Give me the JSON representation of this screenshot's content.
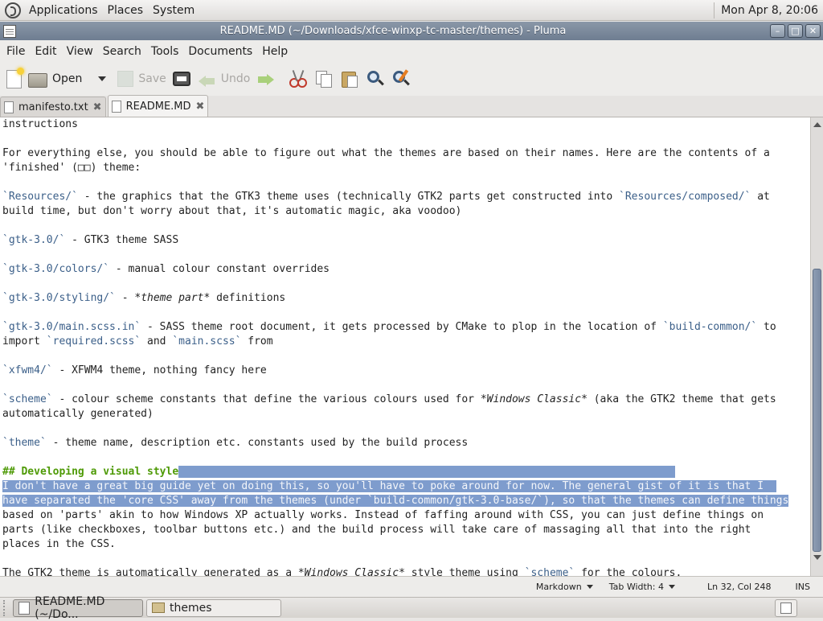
{
  "top_panel": {
    "menus": [
      "Applications",
      "Places",
      "System"
    ],
    "clock": "Mon Apr  8, 20:06"
  },
  "window": {
    "title": "README.MD (~/Downloads/xfce-winxp-tc-master/themes) - Pluma"
  },
  "menubar": {
    "items": [
      "File",
      "Edit",
      "View",
      "Search",
      "Tools",
      "Documents",
      "Help"
    ]
  },
  "toolbar": {
    "open_label": "Open",
    "save_label": "Save",
    "undo_label": "Undo"
  },
  "tabs": [
    {
      "label": "manifesto.txt",
      "active": false
    },
    {
      "label": "README.MD",
      "active": true
    }
  ],
  "editor": {
    "lines": [
      [
        {
          "t": "instructions"
        }
      ],
      [
        {
          "t": ""
        }
      ],
      [
        {
          "t": "For everything else, you should be able to figure out what the themes are based on their names. Here are the contents of a"
        }
      ],
      [
        {
          "t": "'finished' (□□) theme:"
        }
      ],
      [
        {
          "t": ""
        }
      ],
      [
        {
          "t": "`Resources/`",
          "c": "code"
        },
        {
          "t": " - the graphics that the GTK3 theme uses (technically GTK2 parts get constructed into "
        },
        {
          "t": "`Resources/composed/`",
          "c": "code"
        },
        {
          "t": " at"
        }
      ],
      [
        {
          "t": "build time, but don't worry about that, it's automatic magic, aka voodoo)"
        }
      ],
      [
        {
          "t": ""
        }
      ],
      [
        {
          "t": "`gtk-3.0/`",
          "c": "code"
        },
        {
          "t": " - GTK3 theme SASS"
        }
      ],
      [
        {
          "t": ""
        }
      ],
      [
        {
          "t": "`gtk-3.0/colors/`",
          "c": "code"
        },
        {
          "t": " - manual colour constant overrides"
        }
      ],
      [
        {
          "t": ""
        }
      ],
      [
        {
          "t": "`gtk-3.0/styling/`",
          "c": "code"
        },
        {
          "t": " - "
        },
        {
          "t": "*theme part*",
          "c": "emph"
        },
        {
          "t": " definitions"
        }
      ],
      [
        {
          "t": ""
        }
      ],
      [
        {
          "t": "`gtk-3.0/main.scss.in`",
          "c": "code"
        },
        {
          "t": " - SASS theme root document, it gets processed by CMake to plop in the location of "
        },
        {
          "t": "`build-common/`",
          "c": "code"
        },
        {
          "t": " to"
        }
      ],
      [
        {
          "t": "import "
        },
        {
          "t": "`required.scss`",
          "c": "code"
        },
        {
          "t": " and "
        },
        {
          "t": "`main.scss`",
          "c": "code"
        },
        {
          "t": " from"
        }
      ],
      [
        {
          "t": ""
        }
      ],
      [
        {
          "t": "`xfwm4/`",
          "c": "code"
        },
        {
          "t": " - XFWM4 theme, nothing fancy here"
        }
      ],
      [
        {
          "t": ""
        }
      ],
      [
        {
          "t": "`scheme`",
          "c": "code"
        },
        {
          "t": " - colour scheme constants that define the various colours used for "
        },
        {
          "t": "*Windows Classic*",
          "c": "emph"
        },
        {
          "t": " (aka the GTK2 theme that gets"
        }
      ],
      [
        {
          "t": "automatically generated)"
        }
      ],
      [
        {
          "t": ""
        }
      ],
      [
        {
          "t": "`theme`",
          "c": "code"
        },
        {
          "t": " - theme name, description etc. constants used by the build process"
        }
      ],
      [
        {
          "t": ""
        }
      ],
      [
        {
          "t": "## Developing a visual style",
          "c": "heading"
        },
        {
          "t": "                                                                               ",
          "c": "sel"
        }
      ],
      [
        {
          "t": "I don't have a great big guide yet on doing this, so you'll have to poke around for now. The general gist of it is that I  ",
          "c": "sel"
        }
      ],
      [
        {
          "t": "have separated the 'core CSS' away from the themes (under `build-common/gtk-3.0-base/`), so that the themes can define things",
          "c": "sel"
        }
      ],
      [
        {
          "t": "based on 'parts' akin to how Windows XP actually works. Instead of faffing around with CSS, you can just define things on"
        }
      ],
      [
        {
          "t": "parts (like checkboxes, toolbar buttons etc.) and the build process will take care of massaging all that into the right"
        }
      ],
      [
        {
          "t": "places in the CSS."
        }
      ],
      [
        {
          "t": ""
        }
      ],
      [
        {
          "t": "The GTK2 theme is automatically generated as a "
        },
        {
          "t": "*Windows Classic*",
          "c": "emph"
        },
        {
          "t": " style theme using "
        },
        {
          "t": "`scheme`",
          "c": "code"
        },
        {
          "t": " for the colours."
        }
      ]
    ]
  },
  "statusbar": {
    "language": "Markdown",
    "tab_width": "Tab Width:  4",
    "position": "Ln 32, Col 248",
    "mode": "INS"
  },
  "taskbar": {
    "items": [
      {
        "label": "README.MD (~/Do...",
        "active": true
      },
      {
        "label": "themes",
        "active": false
      }
    ]
  }
}
